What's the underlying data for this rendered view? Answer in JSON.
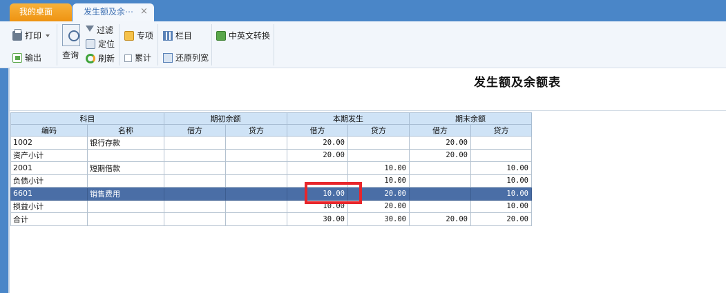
{
  "tabs": {
    "home": "我的桌面",
    "active": "发生额及余⋯",
    "close": "×"
  },
  "toolbar": {
    "print": "打印",
    "export": "输出",
    "query": "查询",
    "filter": "过滤",
    "locate": "定位",
    "refresh": "刷新",
    "special": "专项",
    "cumulative": "累计",
    "columns": "栏目",
    "restore_width": "还原列宽",
    "lang_switch": "中英文转换"
  },
  "report": {
    "title": "发生额及余额表",
    "group_headers": [
      "科目",
      "期初余额",
      "本期发生",
      "期末余额"
    ],
    "sub_headers": [
      "编码",
      "名称",
      "借方",
      "贷方",
      "借方",
      "贷方",
      "借方",
      "贷方"
    ],
    "rows": [
      {
        "code": "1002",
        "name": "银行存款",
        "open_debit": "",
        "open_credit": "",
        "cur_debit": "20.00",
        "cur_credit": "",
        "end_debit": "20.00",
        "end_credit": ""
      },
      {
        "code": "资产小计",
        "name": "",
        "open_debit": "",
        "open_credit": "",
        "cur_debit": "20.00",
        "cur_credit": "",
        "end_debit": "20.00",
        "end_credit": ""
      },
      {
        "code": "2001",
        "name": "短期借款",
        "open_debit": "",
        "open_credit": "",
        "cur_debit": "",
        "cur_credit": "10.00",
        "end_debit": "",
        "end_credit": "10.00"
      },
      {
        "code": "负债小计",
        "name": "",
        "open_debit": "",
        "open_credit": "",
        "cur_debit": "",
        "cur_credit": "10.00",
        "end_debit": "",
        "end_credit": "10.00"
      },
      {
        "code": "6601",
        "name": "销售费用",
        "open_debit": "",
        "open_credit": "",
        "cur_debit": "10.00",
        "cur_credit": "20.00",
        "end_debit": "",
        "end_credit": "10.00"
      },
      {
        "code": "损益小计",
        "name": "",
        "open_debit": "",
        "open_credit": "",
        "cur_debit": "10.00",
        "cur_credit": "20.00",
        "end_debit": "",
        "end_credit": "10.00"
      },
      {
        "code": "合计",
        "name": "",
        "open_debit": "",
        "open_credit": "",
        "cur_debit": "30.00",
        "cur_credit": "30.00",
        "end_debit": "20.00",
        "end_credit": "20.00"
      }
    ]
  },
  "colors": {
    "tabbar": "#4a86c8",
    "home_tab": "#f39c1a",
    "header_bg": "#cfe3f6",
    "selected_row": "#4a6ea6",
    "highlight": "#e8262b"
  }
}
